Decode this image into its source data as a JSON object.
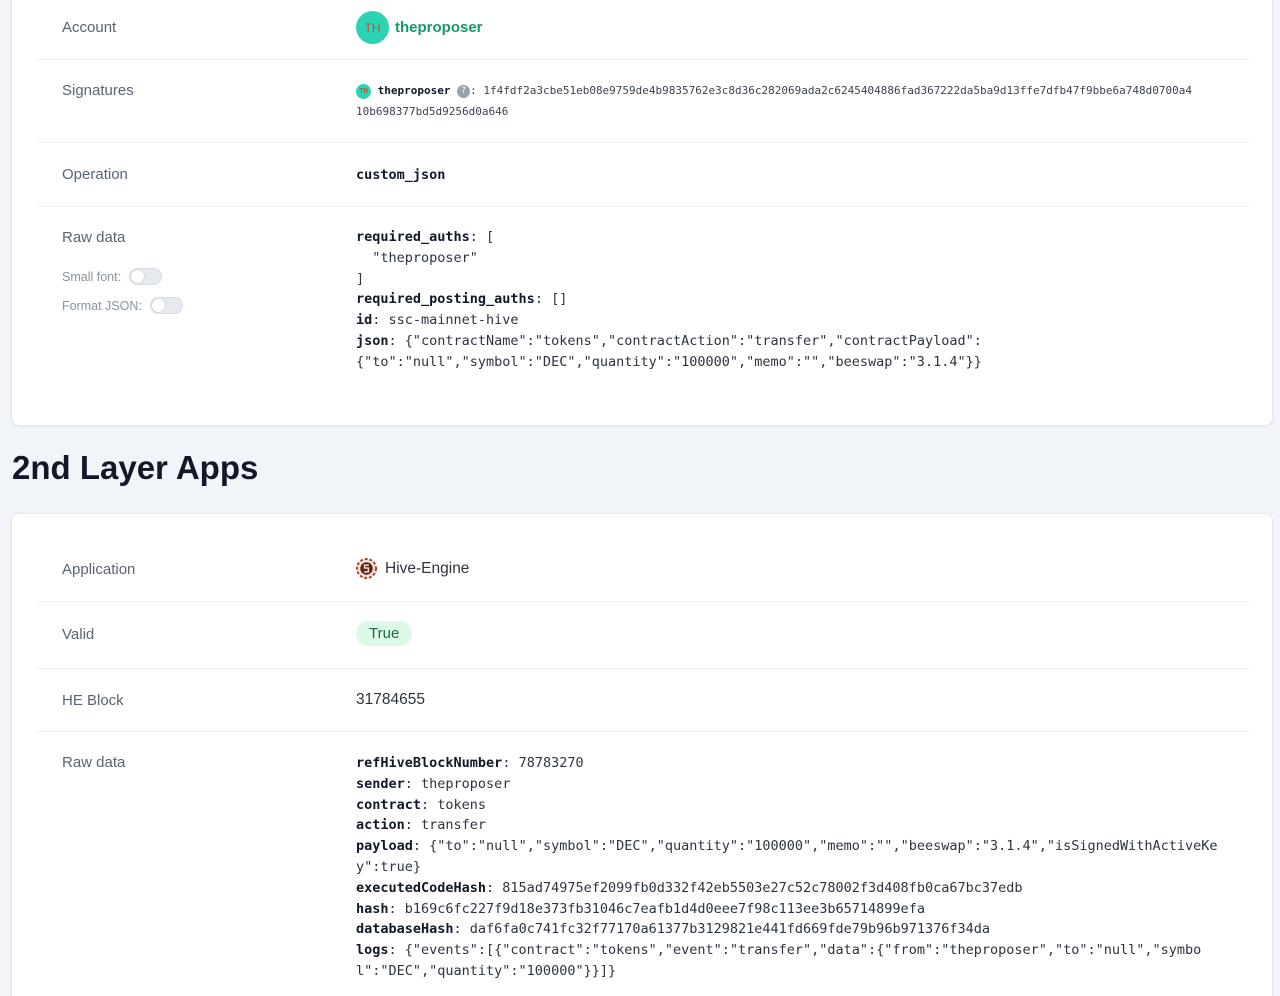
{
  "transaction": {
    "account_label": "Account",
    "account_avatar": "TH",
    "account_name": "theproposer",
    "signatures_label": "Signatures",
    "signature_avatar": "TH",
    "signature_account": "theproposer",
    "signature_help": "?",
    "signature_value_line1": ": 1f4fdf2a3cbe51eb08e9759de4b9835762e3c8d36c282069ada2c6245404886fad367222da5ba9d13ffe7dfb47f9bbe6a748d0700a4",
    "signature_value_line2": "10b698377bd5d9256d0a646",
    "operation_label": "Operation",
    "operation_value": "custom_json",
    "raw_label": "Raw data",
    "small_font_label": "Small font:",
    "format_json_label": "Format JSON:",
    "raw": {
      "required_auths_key": "required_auths",
      "required_auths_open": ": [",
      "required_auths_item": "  \"theproposer\"",
      "required_auths_close": "]",
      "required_posting_auths_key": "required_posting_auths",
      "required_posting_auths_value": ": []",
      "id_key": "id",
      "id_value": ": ssc-mainnet-hive",
      "json_key": "json",
      "json_value_line1": ": {\"contractName\":\"tokens\",\"contractAction\":\"transfer\",\"contractPayload\":",
      "json_value_line2": "{\"to\":\"null\",\"symbol\":\"DEC\",\"quantity\":\"100000\",\"memo\":\"\",\"beeswap\":\"3.1.4\"}}"
    }
  },
  "section_title": "2nd Layer Apps",
  "layer2": {
    "application_label": "Application",
    "application_value": "Hive-Engine",
    "valid_label": "Valid",
    "valid_value": "True",
    "he_block_label": "HE Block",
    "he_block_value": "31784655",
    "raw_label": "Raw data",
    "raw": {
      "refHiveBlockNumber_key": "refHiveBlockNumber",
      "refHiveBlockNumber_value": ": 78783270",
      "sender_key": "sender",
      "sender_value": ": theproposer",
      "contract_key": "contract",
      "contract_value": ": tokens",
      "action_key": "action",
      "action_value": ": transfer",
      "payload_key": "payload",
      "payload_value_line1": ": {\"to\":\"null\",\"symbol\":\"DEC\",\"quantity\":\"100000\",\"memo\":\"\",\"beeswap\":\"3.1.4\",\"isSignedWithActiveKe",
      "payload_value_line2": "y\":true}",
      "executedCodeHash_key": "executedCodeHash",
      "executedCodeHash_value": ": 815ad74975ef2099fb0d332f42eb5503e27c52c78002f3d408fb0ca67bc37edb",
      "hash_key": "hash",
      "hash_value": ": b169c6fc227f9d18e373fb31046c7eafb1d4d0eee7f98c113ee3b65714899efa",
      "databaseHash_key": "databaseHash",
      "databaseHash_value": ": daf6fa0c741fc32f77170a61377b3129821e441fd669fde79b96b971376f34da",
      "logs_key": "logs",
      "logs_value_line1": ": {\"events\":[{\"contract\":\"tokens\",\"event\":\"transfer\",\"data\":{\"from\":\"theproposer\",\"to\":\"null\",\"symbo",
      "logs_value_line2": "l\":\"DEC\",\"quantity\":\"100000\"}}]}"
    }
  },
  "colors": {
    "page_bg": "#f1f5fa",
    "accent_green": "#139a6b",
    "avatar_bg": "#2dd4b4",
    "valid_badge_bg": "#dcf8e6"
  },
  "icons": {
    "hive_engine": "hive-engine-logo-icon",
    "help": "question-circle-icon"
  }
}
